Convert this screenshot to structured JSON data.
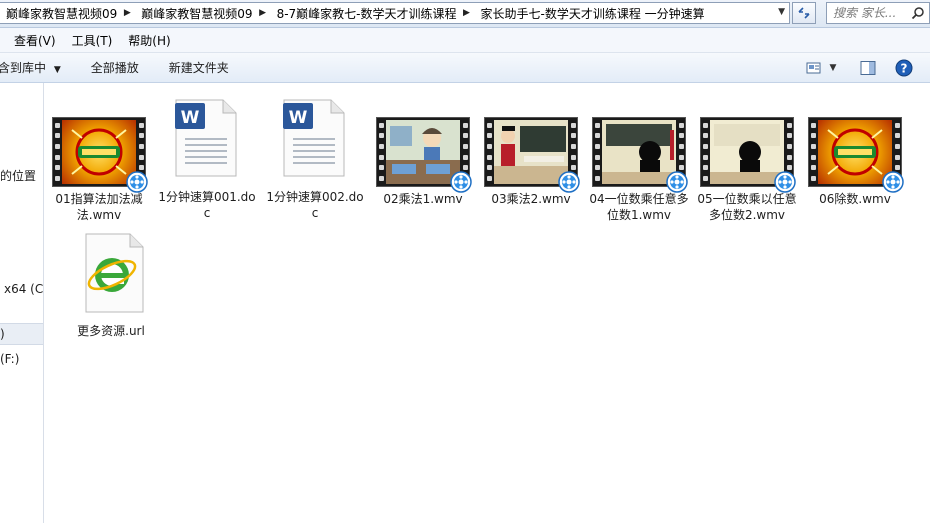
{
  "address_bar": {
    "crumbs": [
      "巅峰家教智慧视频09",
      "巅峰家教智慧视频09",
      "8-7巅峰家教七-数学天才训练课程",
      "家长助手七-数学天才训练课程 一分钟速算"
    ]
  },
  "search": {
    "placeholder": "搜索 家长..."
  },
  "menu": {
    "items": [
      "查看(V)",
      "工具(T)",
      "帮助(H)"
    ]
  },
  "commands": {
    "add_to_library": "含到库中",
    "play_all": "全部播放",
    "new_folder": "新建文件夹"
  },
  "nav": {
    "items": [
      "的位置",
      "x64 (C:",
      ")",
      "(F:)"
    ]
  },
  "files": [
    {
      "name": "01指算法加法减法.wmv",
      "type": "video",
      "frame": "title"
    },
    {
      "name": "1分钟速算001.doc",
      "type": "word"
    },
    {
      "name": "1分钟速算002.doc",
      "type": "word"
    },
    {
      "name": "02乘法1.wmv",
      "type": "video",
      "frame": "classroom"
    },
    {
      "name": "03乘法2.wmv",
      "type": "video",
      "frame": "teacher"
    },
    {
      "name": "04一位数乘任意多位数1.wmv",
      "type": "video",
      "frame": "silhouette"
    },
    {
      "name": "05一位数乘以任意多位数2.wmv",
      "type": "video",
      "frame": "silhouette-light"
    },
    {
      "name": "06除数.wmv",
      "type": "video",
      "frame": "title"
    },
    {
      "name": "更多资源.url",
      "type": "url"
    }
  ],
  "colors": {
    "toolbar": "#e3ecf7",
    "border": "#8e9fb7",
    "word_blue": "#2b579a",
    "ie_green": "#3aa83a"
  }
}
